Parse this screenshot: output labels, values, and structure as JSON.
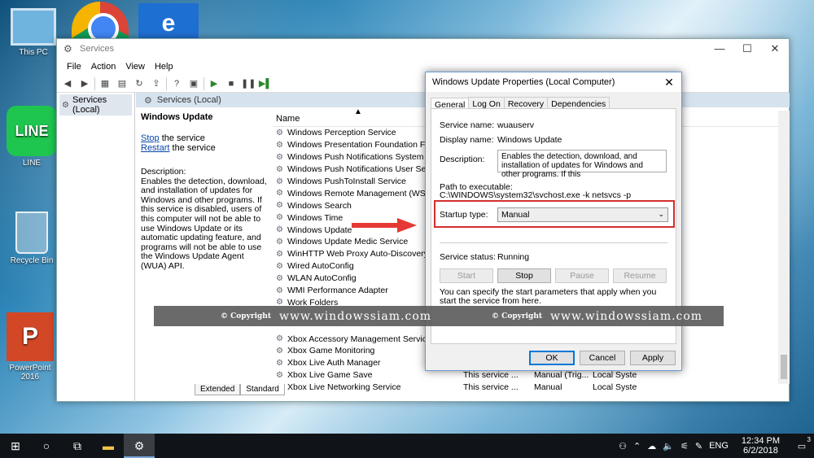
{
  "desktop": {
    "icons": [
      {
        "label": "This PC"
      },
      {
        "label": "LINE"
      },
      {
        "label": "Recycle Bin"
      },
      {
        "label": "PowerPoint 2016"
      }
    ]
  },
  "services_window": {
    "title": "Services",
    "menu": [
      "File",
      "Action",
      "View",
      "Help"
    ],
    "tree_item": "Services (Local)",
    "pane_header": "Services (Local)",
    "selected_service_title": "Windows Update",
    "stop_link": "Stop",
    "stop_rest": " the service",
    "restart_link": "Restart",
    "restart_rest": " the service",
    "description_label": "Description:",
    "description_text": "Enables the detection, download, and installation of updates for Windows and other programs. If this service is disabled, users of this computer will not be able to use Windows Update or its automatic updating feature, and programs will not be able to use the Windows Update Agent (WUA) API.",
    "column_name": "Name",
    "services": [
      {
        "name": "Windows Perception Service",
        "desc": "",
        "status": "",
        "logon": ""
      },
      {
        "name": "Windows Presentation Foundation Font C",
        "desc": "",
        "status": "",
        "logon": ""
      },
      {
        "name": "Windows Push Notifications System Servic",
        "desc": "",
        "status": "",
        "logon": ""
      },
      {
        "name": "Windows Push Notifications User Service_",
        "desc": "",
        "status": "",
        "logon": ""
      },
      {
        "name": "Windows PushToInstall Service",
        "desc": "",
        "status": "",
        "logon": ""
      },
      {
        "name": "Windows Remote Management (WS-Man",
        "desc": "",
        "status": "",
        "logon": ""
      },
      {
        "name": "Windows Search",
        "desc": "",
        "status": "",
        "logon": ""
      },
      {
        "name": "Windows Time",
        "desc": "",
        "status": "",
        "logon": ""
      },
      {
        "name": "Windows Update",
        "desc": "",
        "status": "",
        "logon": ""
      },
      {
        "name": "Windows Update Medic Service",
        "desc": "",
        "status": "",
        "logon": ""
      },
      {
        "name": "WinHTTP Web Proxy Auto-Discovery Serv",
        "desc": "",
        "status": "",
        "logon": ""
      },
      {
        "name": "Wired AutoConfig",
        "desc": "",
        "status": "",
        "logon": ""
      },
      {
        "name": "WLAN AutoConfig",
        "desc": "",
        "status": "",
        "logon": ""
      },
      {
        "name": "WMI Performance Adapter",
        "desc": "",
        "status": "",
        "logon": ""
      },
      {
        "name": "Work Folders",
        "desc": "",
        "status": "",
        "logon": ""
      },
      {
        "name": "",
        "desc": "",
        "status": "",
        "logon": ""
      },
      {
        "name": "",
        "desc": "",
        "status": "",
        "logon": ""
      },
      {
        "name": "Xbox Accessory Management Service",
        "desc": "",
        "status": "",
        "logon": ""
      },
      {
        "name": "Xbox Game Monitoring",
        "desc": "",
        "status": "",
        "logon": ""
      },
      {
        "name": "Xbox Live Auth Manager",
        "desc": "",
        "status": "",
        "logon": ""
      },
      {
        "name": "Xbox Live Game Save",
        "desc": "This service ...",
        "status": "Manual (Trig...",
        "logon": "Local Syste"
      },
      {
        "name": "Xbox Live Networking Service",
        "desc": "This service ...",
        "status": "Manual",
        "logon": "Local Syste"
      }
    ],
    "tabs": [
      "Extended",
      "Standard"
    ]
  },
  "dialog": {
    "title": "Windows Update Properties (Local Computer)",
    "tabs": [
      "General",
      "Log On",
      "Recovery",
      "Dependencies"
    ],
    "service_name_label": "Service name:",
    "service_name_value": "wuauserv",
    "display_name_label": "Display name:",
    "display_name_value": "Windows Update",
    "description_label": "Description:",
    "description_value": "Enables the detection, download, and installation of updates for Windows and other programs. If this",
    "path_label": "Path to executable:",
    "path_value": "C:\\WINDOWS\\system32\\svchost.exe -k netsvcs -p",
    "startup_label": "Startup type:",
    "startup_value": "Manual",
    "status_label": "Service status:",
    "status_value": "Running",
    "start_btn": "Start",
    "stop_btn": "Stop",
    "pause_btn": "Pause",
    "resume_btn": "Resume",
    "start_params_text": "You can specify the start parameters that apply when you start the service from here.",
    "ok_btn": "OK",
    "cancel_btn": "Cancel",
    "apply_btn": "Apply"
  },
  "watermark": {
    "copyright": "© Copyright",
    "url": "www.windowssiam.com"
  },
  "taskbar": {
    "lang": "ENG",
    "time": "12:34 PM",
    "date": "6/2/2018",
    "notifications": "3"
  },
  "colors": {
    "highlight_red": "#d32f2f",
    "arrow_red": "#e53935",
    "link_blue": "#0645ad"
  }
}
